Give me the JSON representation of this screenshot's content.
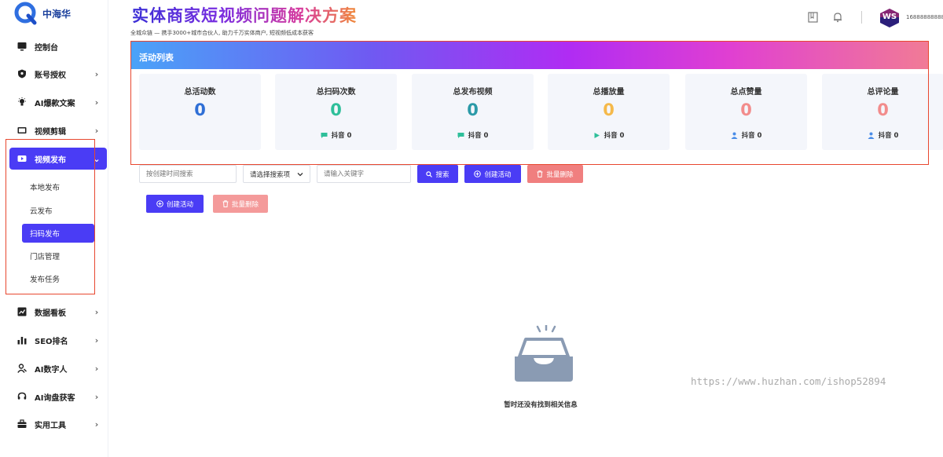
{
  "app": {
    "brand": "中海华",
    "accent": "#4a3cf5"
  },
  "header": {
    "title": "实体商家短视频问题解决方案",
    "subtitle": "全城众链 — 携手3000+城市合伙人, 助力千万实体商户, 短视频低成本获客",
    "avatar_text": "WS",
    "phone": "16888888888"
  },
  "sidebar": {
    "items": [
      {
        "label": "控制台",
        "icon": "monitor-icon",
        "arrow": ""
      },
      {
        "label": "账号授权",
        "icon": "shield-icon",
        "arrow": "›"
      },
      {
        "label": "AI爆款文案",
        "icon": "bulb-icon",
        "arrow": "›"
      },
      {
        "label": "视频剪辑",
        "icon": "video-icon",
        "arrow": "›"
      },
      {
        "label": "视频发布",
        "icon": "send-icon",
        "arrow": "⌄"
      },
      {
        "label": "数据看板",
        "icon": "chart-icon",
        "arrow": "›"
      },
      {
        "label": "SEO排名",
        "icon": "bars-icon",
        "arrow": "›"
      },
      {
        "label": "AI数字人",
        "icon": "person-icon",
        "arrow": "›"
      },
      {
        "label": "AI询盘获客",
        "icon": "headset-icon",
        "arrow": "›"
      },
      {
        "label": "实用工具",
        "icon": "toolbox-icon",
        "arrow": "›"
      }
    ],
    "submenu": [
      {
        "label": "本地发布"
      },
      {
        "label": "云发布"
      },
      {
        "label": "扫码发布"
      },
      {
        "label": "门店管理"
      },
      {
        "label": "发布任务"
      }
    ]
  },
  "main": {
    "section_title": "活动列表",
    "stats": [
      {
        "label": "总活动数",
        "value": "0",
        "color": "#2f6fd6",
        "sub": ""
      },
      {
        "label": "总扫码次数",
        "value": "0",
        "color": "#2ebf9a",
        "sub": "抖音 0",
        "sub_icon": "chat-icon",
        "sub_color": "#2ebf9a"
      },
      {
        "label": "总发布视频",
        "value": "0",
        "color": "#2b9aa8",
        "sub": "抖音 0",
        "sub_icon": "chat-icon",
        "sub_color": "#2ebf9a"
      },
      {
        "label": "总播放量",
        "value": "0",
        "color": "#f5b94a",
        "sub": "抖音 0",
        "sub_icon": "play-icon",
        "sub_color": "#2ebf9a"
      },
      {
        "label": "总点赞量",
        "value": "0",
        "color": "#f28c8c",
        "sub": "抖音 0",
        "sub_icon": "user-icon",
        "sub_color": "#4a8de8"
      },
      {
        "label": "总评论量",
        "value": "0",
        "color": "#f28c8c",
        "sub": "抖音 0",
        "sub_icon": "user-icon",
        "sub_color": "#4a8de8"
      }
    ],
    "filters": {
      "date_placeholder": "按创建时间搜索",
      "select_value": "请选择搜索项",
      "keyword_placeholder": "请输入关键字",
      "search_label": "搜索",
      "create_label": "创建活动",
      "batch_delete_label": "批量删除"
    },
    "actions": {
      "create_label": "创建活动",
      "batch_delete_label": "批量删除"
    },
    "empty_text": "暂时还没有找到相关信息"
  },
  "watermark": "https://www.huzhan.com/ishop52894"
}
